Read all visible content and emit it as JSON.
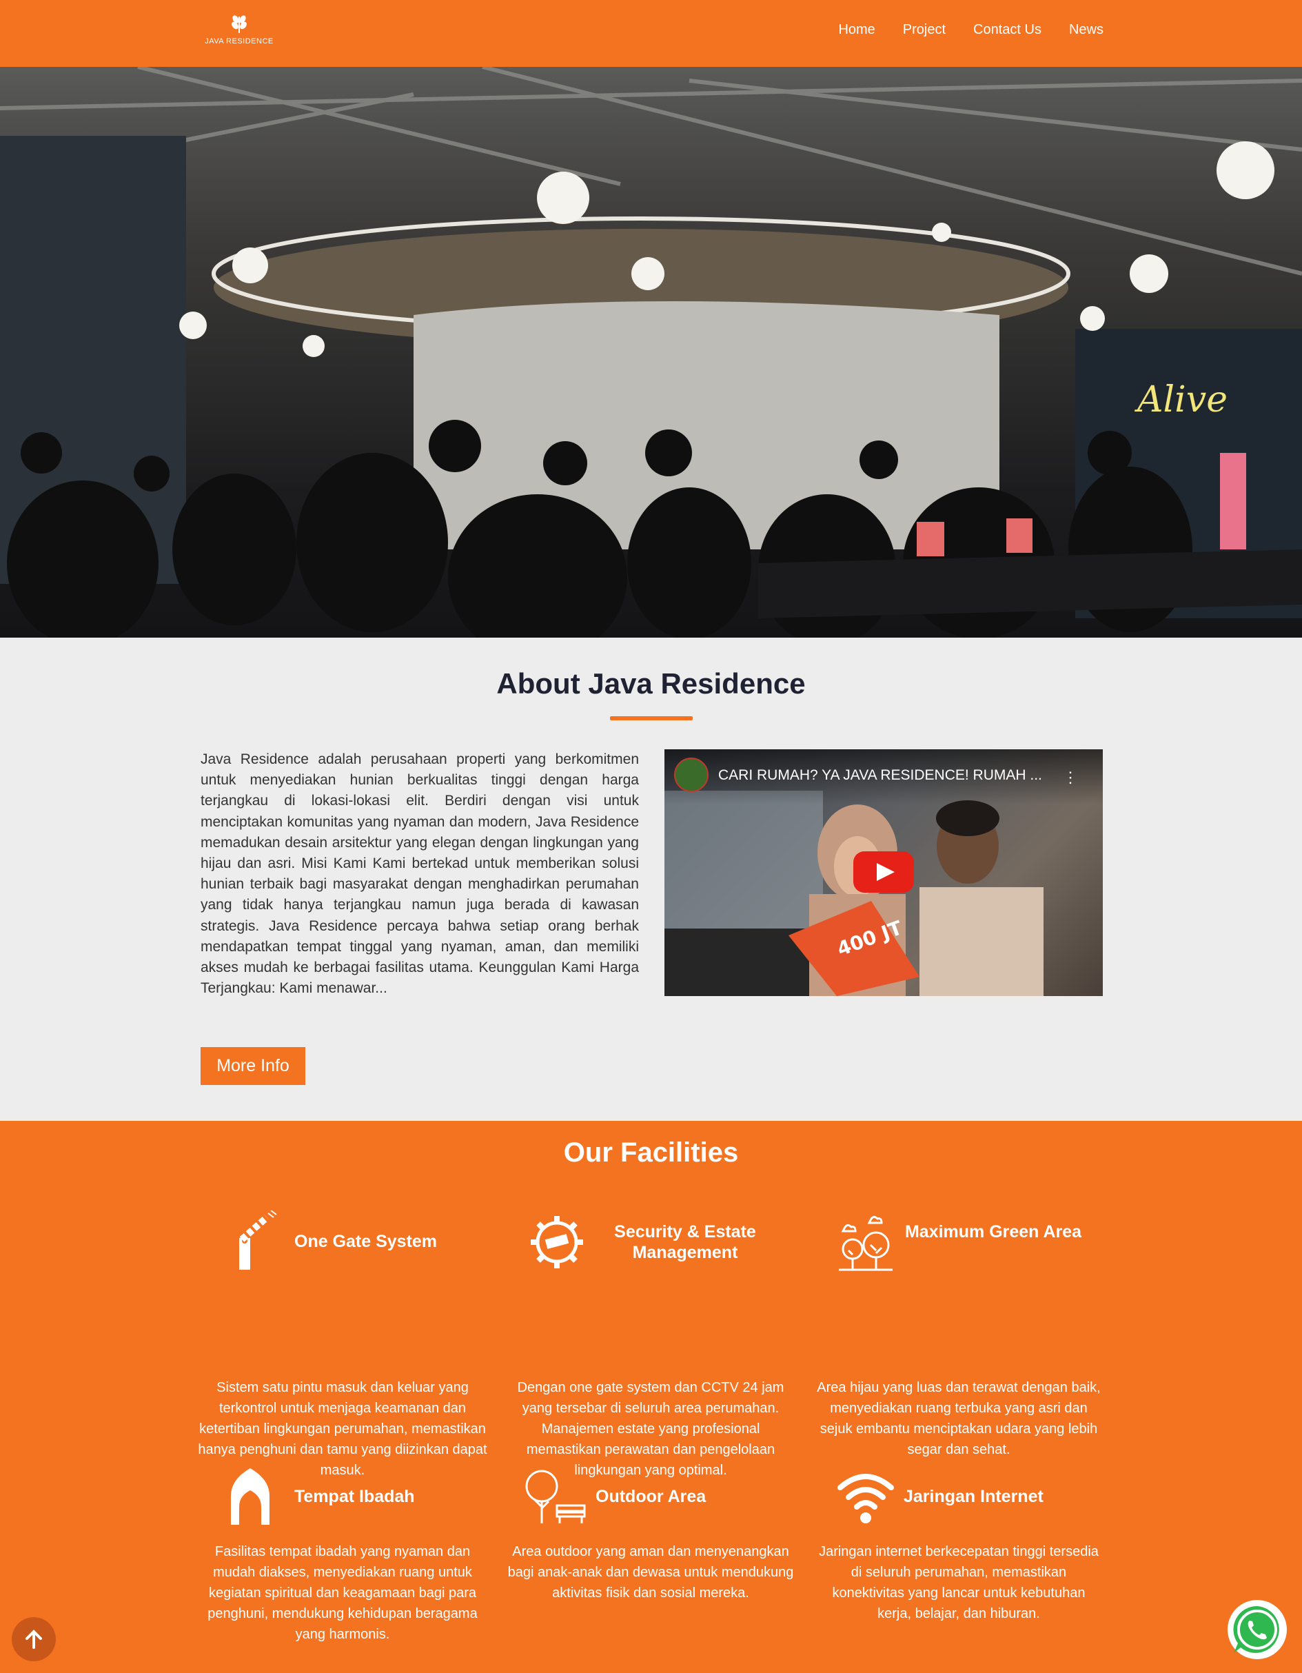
{
  "header": {
    "brand": "JAVA RESIDENCE",
    "nav": [
      "Home",
      "Project",
      "Contact Us",
      "News"
    ]
  },
  "about": {
    "title": "About Java Residence",
    "text": "Java Residence adalah perusahaan properti yang berkomitmen untuk menyediakan hunian berkualitas tinggi dengan harga terjangkau di lokasi-lokasi elit. Berdiri dengan visi untuk menciptakan komunitas yang nyaman dan modern, Java Residence memadukan desain arsitektur yang elegan dengan lingkungan yang hijau dan asri. Misi Kami Kami bertekad untuk memberikan solusi hunian terbaik bagi masyarakat dengan menghadirkan perumahan yang tidak hanya terjangkau namun juga berada di kawasan strategis. Java Residence percaya bahwa setiap orang berhak mendapatkan tempat tinggal yang nyaman, aman, dan memiliki akses mudah ke berbagai fasilitas utama. Keunggulan Kami Harga Terjangkau: Kami menawar...",
    "button": "More Info",
    "video_title": "CARI RUMAH? YA JAVA RESIDENCE! RUMAH ...",
    "video_menu": "⋮"
  },
  "hero": {
    "sign": "Alive"
  },
  "facilities": {
    "title": "Our Facilities",
    "items": [
      {
        "name": "One Gate System",
        "desc": "Sistem satu pintu masuk dan keluar yang terkontrol untuk menjaga keamanan dan ketertiban lingkungan perumahan, memastikan hanya penghuni dan tamu yang diizinkan dapat masuk.",
        "icon": "gate-barrier-icon"
      },
      {
        "name": "Security & Estate Management",
        "desc": "Dengan one gate system dan CCTV 24 jam yang tersebar di seluruh area perumahan. Manajemen estate yang profesional memastikan perawatan dan pengelolaan lingkungan yang optimal.",
        "icon": "cctv-gear-icon"
      },
      {
        "name": "Maximum Green Area",
        "desc": "Area hijau yang luas dan terawat dengan baik, menyediakan ruang terbuka yang asri dan sejuk embantu menciptakan udara yang lebih segar dan sehat.",
        "icon": "trees-icon"
      },
      {
        "name": "Tempat Ibadah",
        "desc": "Fasilitas tempat ibadah yang nyaman dan mudah diakses, menyediakan ruang untuk kegiatan spiritual dan keagamaan bagi para penghuni, mendukung kehidupan beragama yang harmonis.",
        "icon": "mosque-arch-icon"
      },
      {
        "name": "Outdoor Area",
        "desc": "Area outdoor yang aman dan menyenangkan bagi anak-anak dan dewasa untuk mendukung aktivitas fisik dan sosial mereka.",
        "icon": "tree-bench-icon"
      },
      {
        "name": "Jaringan Internet",
        "desc": "Jaringan internet berkecepatan tinggi tersedia di seluruh perumahan, memastikan konektivitas yang lancar untuk kebutuhan kerja, belajar, dan hiburan.",
        "icon": "wifi-icon"
      }
    ]
  },
  "colors": {
    "brand": "#f47321",
    "heading": "#1f2233",
    "background": "#ededed"
  }
}
